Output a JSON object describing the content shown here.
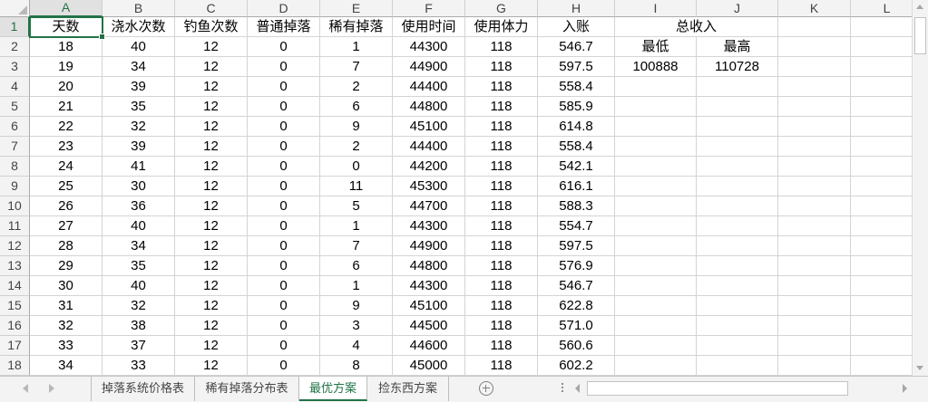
{
  "columns": [
    "A",
    "B",
    "C",
    "D",
    "E",
    "F",
    "G",
    "H",
    "I",
    "J",
    "K",
    "L"
  ],
  "row_numbers": [
    "1",
    "2",
    "3",
    "4",
    "5",
    "6",
    "7",
    "8",
    "9",
    "10",
    "11",
    "12",
    "13",
    "14",
    "15",
    "16",
    "17",
    "18"
  ],
  "cells": [
    [
      "天数",
      "浇水次数",
      "钓鱼次数",
      "普通掉落",
      "稀有掉落",
      "使用时间",
      "使用体力",
      "入账",
      "总收入"
    ],
    [
      "18",
      "40",
      "12",
      "0",
      "1",
      "44300",
      "118",
      "546.7",
      "最低",
      "最高"
    ],
    [
      "19",
      "34",
      "12",
      "0",
      "7",
      "44900",
      "118",
      "597.5",
      "100888",
      "110728"
    ],
    [
      "20",
      "39",
      "12",
      "0",
      "2",
      "44400",
      "118",
      "558.4"
    ],
    [
      "21",
      "35",
      "12",
      "0",
      "6",
      "44800",
      "118",
      "585.9"
    ],
    [
      "22",
      "32",
      "12",
      "0",
      "9",
      "45100",
      "118",
      "614.8"
    ],
    [
      "23",
      "39",
      "12",
      "0",
      "2",
      "44400",
      "118",
      "558.4"
    ],
    [
      "24",
      "41",
      "12",
      "0",
      "0",
      "44200",
      "118",
      "542.1"
    ],
    [
      "25",
      "30",
      "12",
      "0",
      "11",
      "45300",
      "118",
      "616.1"
    ],
    [
      "26",
      "36",
      "12",
      "0",
      "5",
      "44700",
      "118",
      "588.3"
    ],
    [
      "27",
      "40",
      "12",
      "0",
      "1",
      "44300",
      "118",
      "554.7"
    ],
    [
      "28",
      "34",
      "12",
      "0",
      "7",
      "44900",
      "118",
      "597.5"
    ],
    [
      "29",
      "35",
      "12",
      "0",
      "6",
      "44800",
      "118",
      "576.9"
    ],
    [
      "30",
      "40",
      "12",
      "0",
      "1",
      "44300",
      "118",
      "546.7"
    ],
    [
      "31",
      "32",
      "12",
      "0",
      "9",
      "45100",
      "118",
      "622.8"
    ],
    [
      "32",
      "38",
      "12",
      "0",
      "3",
      "44500",
      "118",
      "571.0"
    ],
    [
      "33",
      "37",
      "12",
      "0",
      "4",
      "44600",
      "118",
      "560.6"
    ],
    [
      "34",
      "33",
      "12",
      "0",
      "8",
      "45000",
      "118",
      "602.2"
    ]
  ],
  "active_cell": {
    "row_index": 0,
    "column_index": 0
  },
  "sheet_tabs": {
    "tabs": [
      "掉落系统价格表",
      "稀有掉落分布表",
      "最优方案",
      "捡东西方案"
    ],
    "active_index": 2
  },
  "icons": {
    "select_all": "select-all-triangle-icon",
    "sheet_prev": "sheet-prev-icon",
    "sheet_next": "sheet-next-icon",
    "add_sheet": "plus-icon",
    "split_handle": "tab-split-handle-icon",
    "scroll_up": "scroll-up-icon",
    "scroll_down": "scroll-down-icon",
    "scroll_left": "scroll-left-icon",
    "scroll_right": "scroll-right-icon"
  },
  "colors": {
    "accent": "#217346",
    "gridline": "#d4d4d4",
    "header_background": "#f3f3f3",
    "header_text": "#444444",
    "cell_text": "#000000"
  }
}
